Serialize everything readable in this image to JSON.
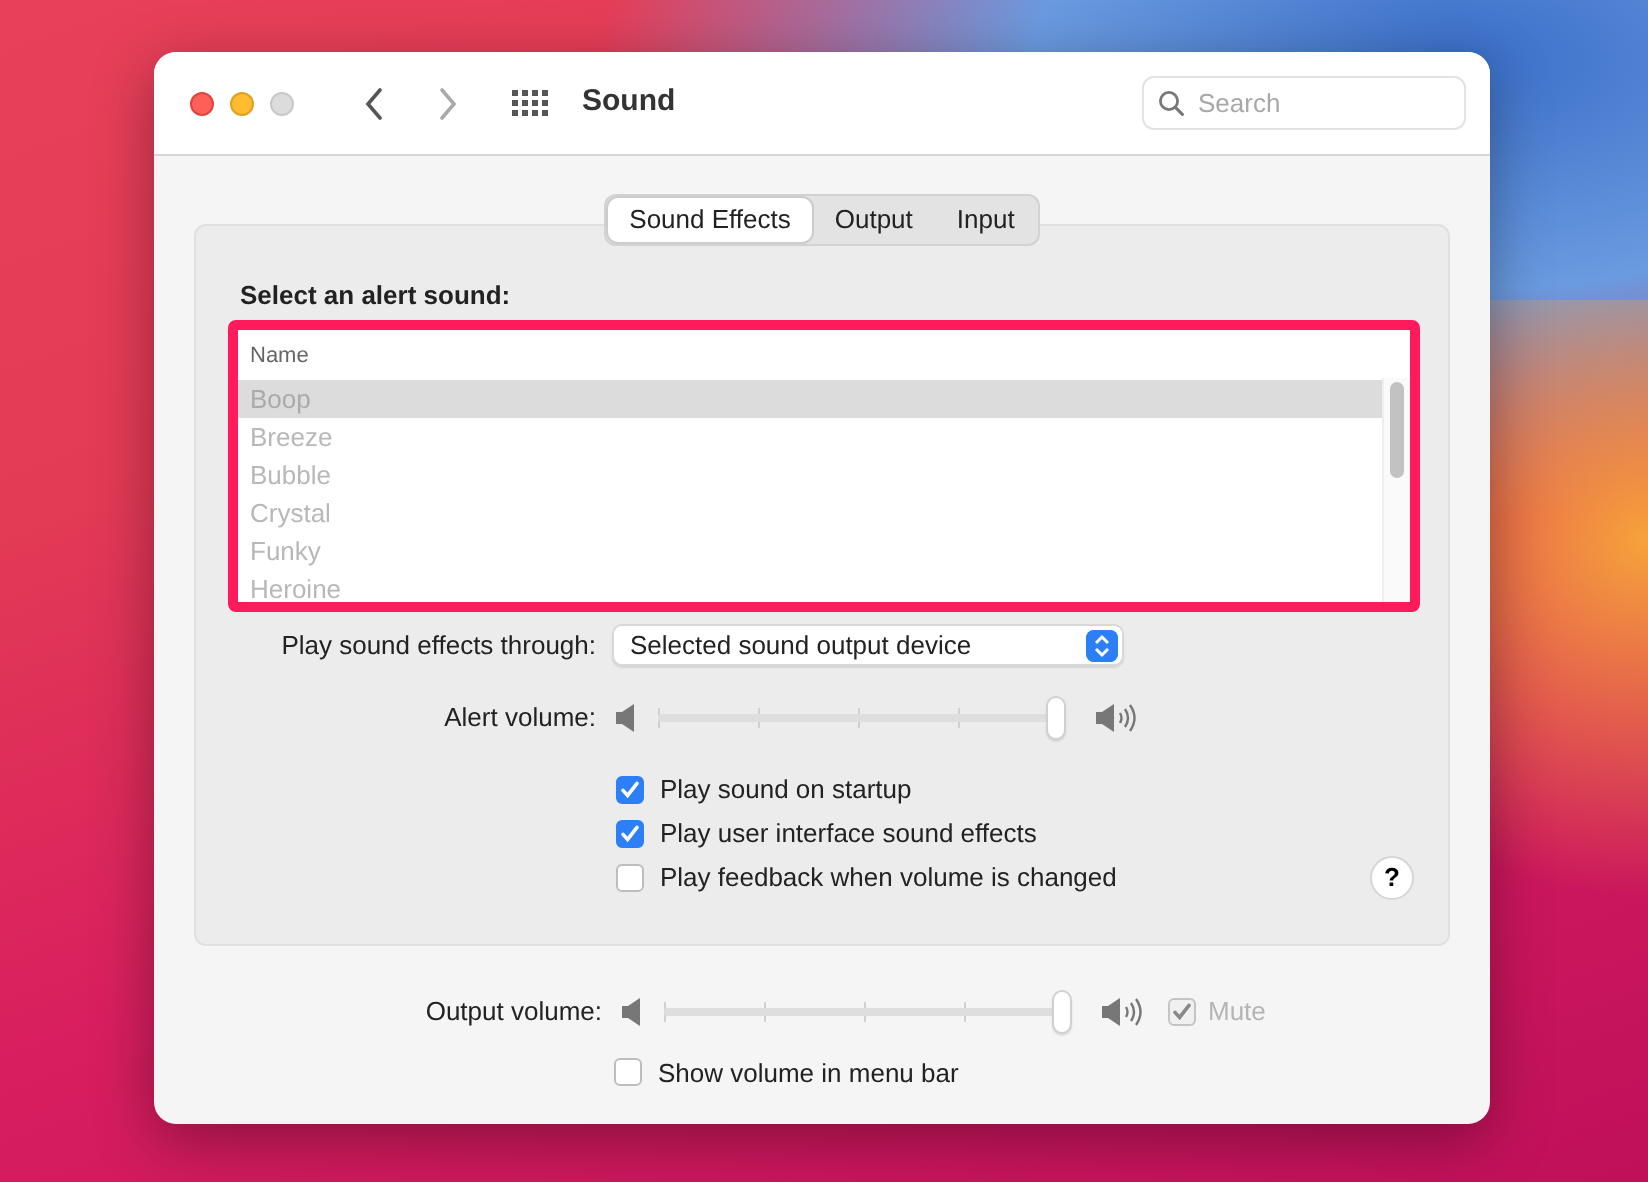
{
  "window": {
    "title": "Sound",
    "search": {
      "placeholder": "Search"
    }
  },
  "tabs": [
    {
      "label": "Sound Effects",
      "selected": true
    },
    {
      "label": "Output",
      "selected": false
    },
    {
      "label": "Input",
      "selected": false
    }
  ],
  "alert_list": {
    "heading": "Select an alert sound:",
    "highlighted": true,
    "column": "Name",
    "rows": [
      {
        "label": "Boop",
        "selected": true
      },
      {
        "label": "Breeze",
        "selected": false
      },
      {
        "label": "Bubble",
        "selected": false
      },
      {
        "label": "Crystal",
        "selected": false
      },
      {
        "label": "Funky",
        "selected": false
      },
      {
        "label": "Heroine",
        "selected": false
      }
    ]
  },
  "play_through": {
    "label": "Play sound effects through:",
    "value": "Selected sound output device"
  },
  "alert_volume": {
    "label": "Alert volume:",
    "level": 1.0
  },
  "options": [
    {
      "label": "Play sound on startup",
      "checked": true
    },
    {
      "label": "Play user interface sound effects",
      "checked": true
    },
    {
      "label": "Play feedback when volume is changed",
      "checked": false
    }
  ],
  "help_button": "?",
  "output_volume": {
    "label": "Output volume:",
    "level": 1.0
  },
  "mute": {
    "label": "Mute",
    "checked": true,
    "disabled": true
  },
  "menu_bar_option": {
    "label": "Show volume in menu bar",
    "checked": false
  }
}
